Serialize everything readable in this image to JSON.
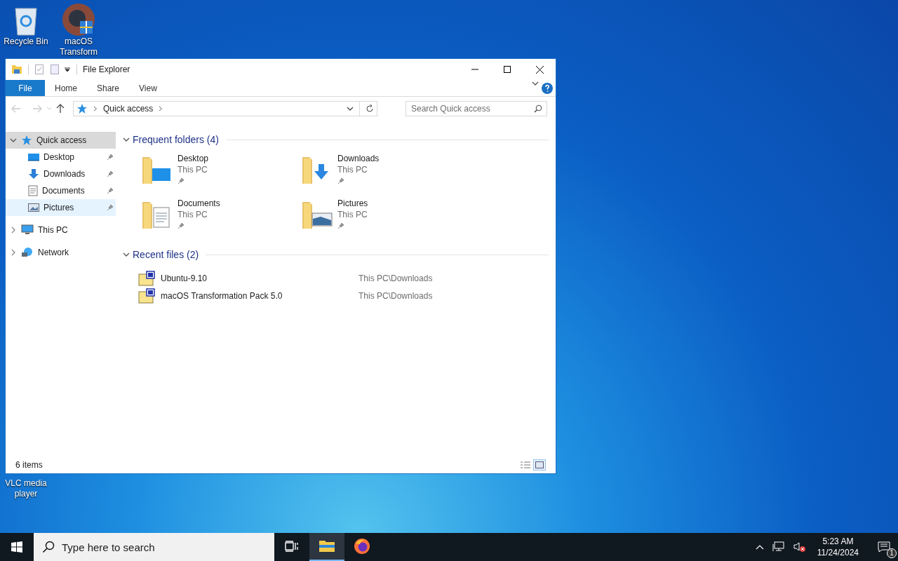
{
  "desktop_icons": [
    {
      "label": "Recycle Bin",
      "kind": "recycle"
    },
    {
      "label": "macOS Transform",
      "kind": "app"
    },
    {
      "label": "VLC media player",
      "kind": "vlc"
    }
  ],
  "window": {
    "title": "File Explorer"
  },
  "ribbon_tabs": [
    {
      "label": "File",
      "kind": "file"
    },
    {
      "label": "Home",
      "kind": "tab"
    },
    {
      "label": "Share",
      "kind": "tab"
    },
    {
      "label": "View",
      "kind": "tab"
    }
  ],
  "address": {
    "path": "Quick access"
  },
  "search": {
    "placeholder": "Search Quick access"
  },
  "nav": [
    {
      "label": "Quick access",
      "kind": "quick",
      "selected": true,
      "expanded": true,
      "children": [
        {
          "label": "Desktop",
          "kind": "desktop",
          "pinned": true,
          "hovered": false
        },
        {
          "label": "Downloads",
          "kind": "downloads",
          "pinned": true,
          "hovered": false
        },
        {
          "label": "Documents",
          "kind": "documents",
          "pinned": true,
          "hovered": false
        },
        {
          "label": "Pictures",
          "kind": "pictures",
          "pinned": true,
          "hovered": true
        }
      ]
    },
    {
      "label": "This PC",
      "kind": "pc",
      "selected": false,
      "expanded": false
    },
    {
      "label": "Network",
      "kind": "network",
      "selected": false,
      "expanded": false
    }
  ],
  "sections": [
    {
      "title": "Frequent folders (4)",
      "kind": "tiles",
      "expanded": true,
      "items": [
        {
          "name": "Desktop",
          "location": "This PC",
          "kind": "desktop",
          "pinned": true
        },
        {
          "name": "Downloads",
          "location": "This PC",
          "kind": "downloads",
          "pinned": true
        },
        {
          "name": "Documents",
          "location": "This PC",
          "kind": "documents",
          "pinned": true
        },
        {
          "name": "Pictures",
          "location": "This PC",
          "kind": "pictures",
          "pinned": true
        }
      ]
    },
    {
      "title": "Recent files (2)",
      "kind": "list",
      "expanded": true,
      "items": [
        {
          "name": "Ubuntu-9.10",
          "location": "This PC\\Downloads",
          "kind": "iso"
        },
        {
          "name": "macOS Transformation Pack 5.0",
          "location": "This PC\\Downloads",
          "kind": "setup"
        }
      ]
    }
  ],
  "status_bar": {
    "text": "6 items",
    "views": [
      {
        "kind": "details",
        "selected": false
      },
      {
        "kind": "tiles",
        "selected": true
      }
    ]
  },
  "taskbar": {
    "search_placeholder": "Type here to search",
    "apps": [
      {
        "kind": "taskview",
        "active": false
      },
      {
        "kind": "explorer",
        "active": true
      },
      {
        "kind": "firefox",
        "active": false
      }
    ],
    "time": "5:23 AM",
    "date": "11/24/2024",
    "notifications": "1"
  }
}
